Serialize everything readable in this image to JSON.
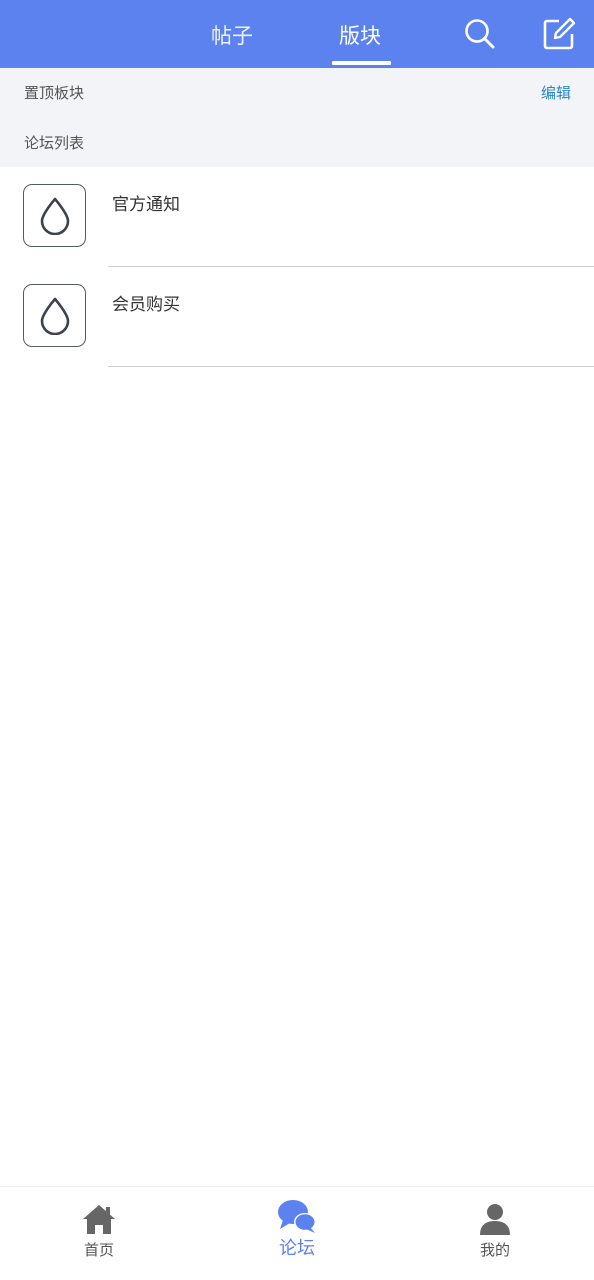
{
  "header": {
    "tabs": [
      {
        "label": "帖子",
        "active": false
      },
      {
        "label": "版块",
        "active": true
      }
    ],
    "actions": [
      {
        "icon": "search-icon"
      },
      {
        "icon": "compose-icon"
      }
    ]
  },
  "pinned": {
    "label": "置顶板块",
    "edit_label": "编辑"
  },
  "forum_list": {
    "label": "论坛列表",
    "items": [
      {
        "name": "官方通知",
        "icon": "water-drop-icon"
      },
      {
        "name": "会员购买",
        "icon": "water-drop-icon"
      }
    ]
  },
  "bottom_nav": {
    "items": [
      {
        "label": "首页",
        "icon": "home-icon",
        "active": false
      },
      {
        "label": "论坛",
        "icon": "chat-bubbles-icon",
        "active": true
      },
      {
        "label": "我的",
        "icon": "user-icon",
        "active": false
      }
    ]
  },
  "colors": {
    "primary": "#5b82ef",
    "band_background": "#f3f4f8",
    "link": "#2a86c8",
    "icon_gray": "#666666"
  }
}
